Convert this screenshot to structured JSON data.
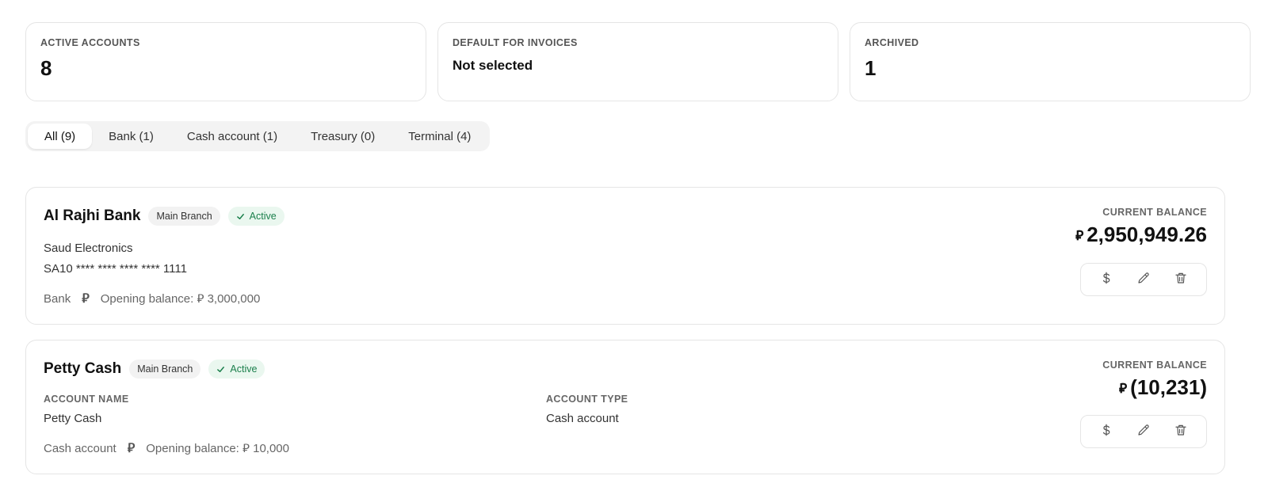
{
  "stats": [
    {
      "label": "ACTIVE ACCOUNTS",
      "value": "8"
    },
    {
      "label": "DEFAULT FOR INVOICES",
      "value": "Not selected"
    },
    {
      "label": "ARCHIVED",
      "value": "1"
    }
  ],
  "tabs": [
    {
      "label": "All (9)"
    },
    {
      "label": "Bank (1)"
    },
    {
      "label": "Cash account (1)"
    },
    {
      "label": "Treasury (0)"
    },
    {
      "label": "Terminal (4)"
    }
  ],
  "currency_symbol": "⃁",
  "accounts": [
    {
      "name": "Al Rajhi Bank",
      "branch": "Main Branch",
      "status": "Active",
      "company": "Saud Electronics",
      "iban": "SA10 **** **** **** **** 1111",
      "type": "Bank",
      "opening_label": "Opening balance:",
      "opening_value": "3,000,000",
      "balance_label": "CURRENT BALANCE",
      "balance": "2,950,949.26"
    },
    {
      "name": "Petty Cash",
      "branch": "Main Branch",
      "status": "Active",
      "account_name_label": "ACCOUNT NAME",
      "account_name": "Petty Cash",
      "account_type_label": "ACCOUNT TYPE",
      "account_type": "Cash account",
      "type": "Cash account",
      "opening_label": "Opening balance:",
      "opening_value": "10,000",
      "balance_label": "CURRENT BALANCE",
      "balance": "(10,231)"
    }
  ],
  "colors": {
    "active_text": "#1a7f4b",
    "active_bg": "#eaf7ef",
    "border": "#e5e5e5"
  },
  "icons": {
    "dollar": "dollar-icon",
    "edit": "pencil-icon",
    "delete": "trash-icon",
    "check": "check-icon"
  }
}
